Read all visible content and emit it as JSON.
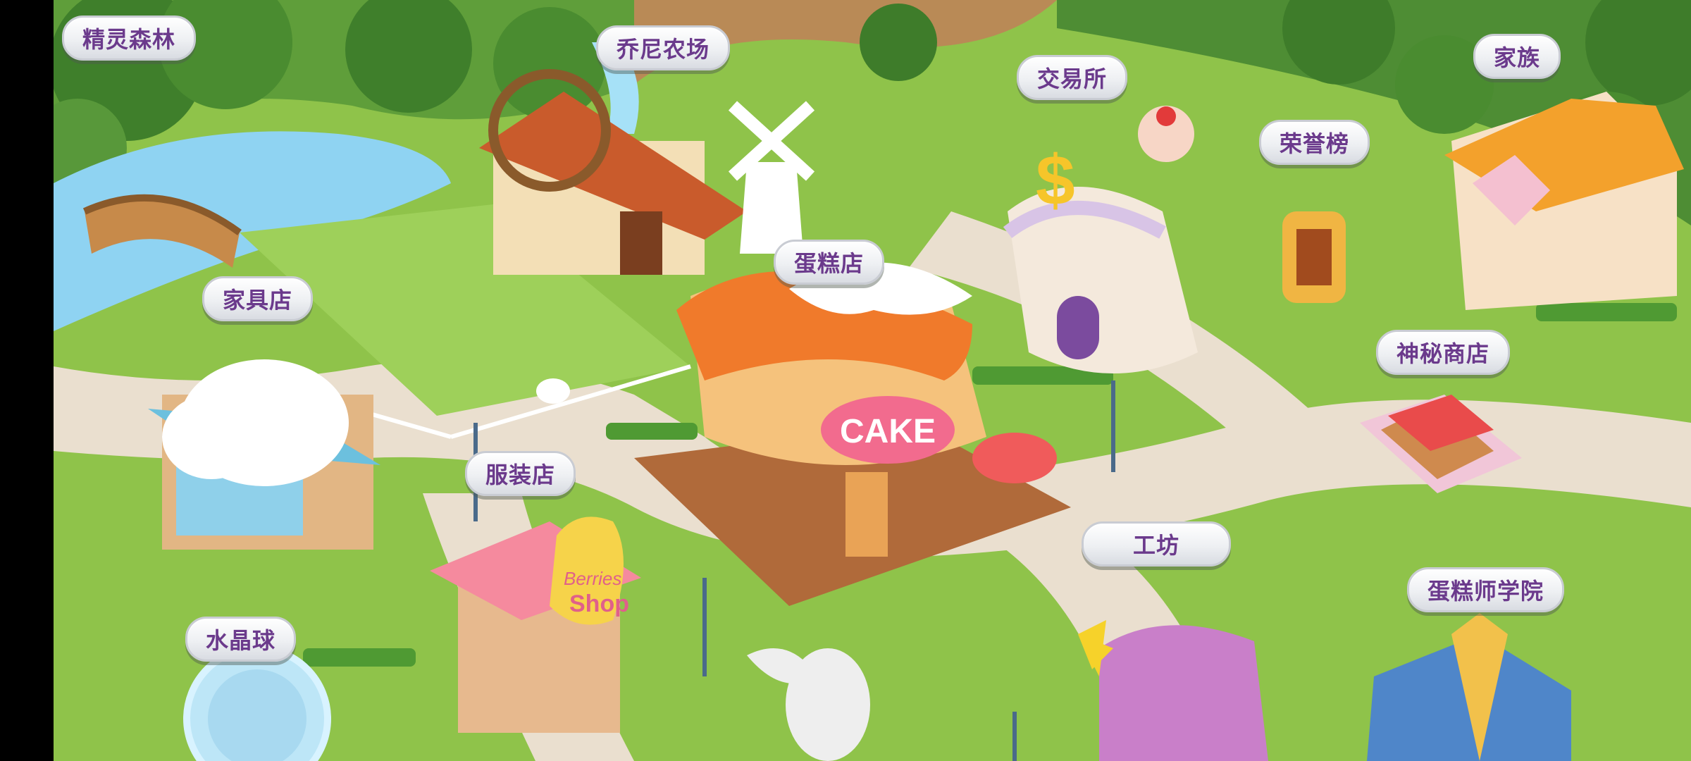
{
  "map": {
    "locations": [
      {
        "id": "elf-forest",
        "label": "精灵森林"
      },
      {
        "id": "joni-farm",
        "label": "乔尼农场"
      },
      {
        "id": "exchange",
        "label": "交易所"
      },
      {
        "id": "family",
        "label": "家族"
      },
      {
        "id": "honor-board",
        "label": "荣誉榜"
      },
      {
        "id": "cake-shop",
        "label": "蛋糕店"
      },
      {
        "id": "furniture-shop",
        "label": "家具店"
      },
      {
        "id": "mystery-shop",
        "label": "神秘商店"
      },
      {
        "id": "clothing-shop",
        "label": "服装店"
      },
      {
        "id": "workshop",
        "label": "工坊"
      },
      {
        "id": "crystal-ball",
        "label": "水晶球"
      },
      {
        "id": "baker-academy",
        "label": "蛋糕师学院"
      }
    ],
    "signs": {
      "cake": "CAKE",
      "berries_shop_line1": "Berries",
      "berries_shop_line2": "Shop"
    }
  },
  "colors": {
    "grass": "#8fc34a",
    "road": "#eadfcf",
    "label_text": "#6b3a8c"
  }
}
